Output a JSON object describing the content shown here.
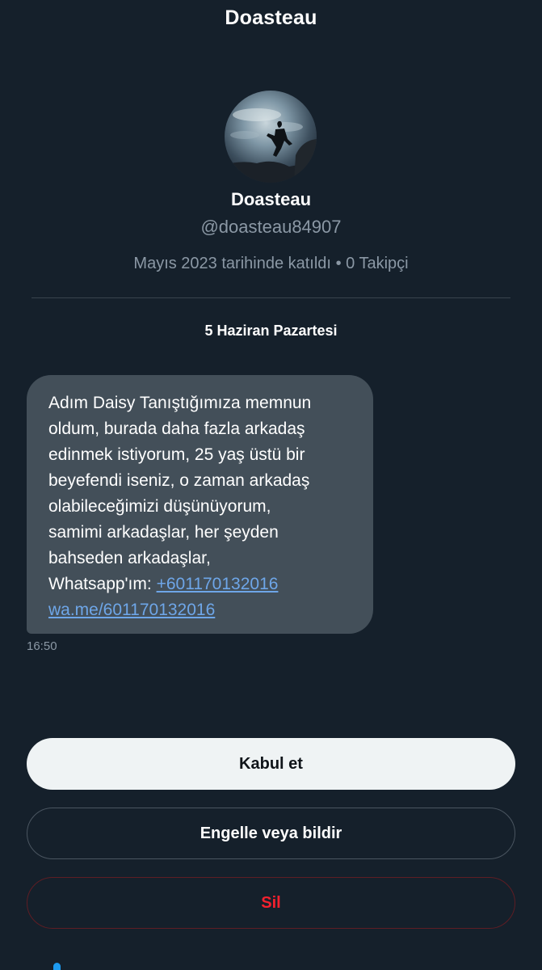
{
  "header": {
    "title": "Doasteau"
  },
  "profile": {
    "avatar_icon": "profile-avatar-photo",
    "name": "Doasteau",
    "handle": "@doasteau84907",
    "joined": "Mayıs 2023 tarihinde katıldı",
    "separator": "•",
    "followers": "0 Takipçi"
  },
  "conversation": {
    "date_separator": "5 Haziran Pazartesi",
    "message": {
      "lines": [
        "Adım Daisy Tanıştığımıza memnun",
        "oldum, burada daha fazla arkadaş",
        "edinmek istiyorum, 25 yaş üstü bir",
        "beyefendi iseniz, o zaman arkadaş",
        "olabileceğimizi düşünüyorum,",
        "samimi arkadaşlar, her şeyden",
        "bahseden arkadaşlar,"
      ],
      "whatsapp_prefix": "Whatsapp'ım:",
      "phone_link": "+601170132016",
      "wa_link": "wa.me/601170132016",
      "time": "16:50"
    }
  },
  "actions": {
    "accept_label": "Kabul et",
    "block_label": "Engelle veya bildir",
    "delete_label": "Sil"
  },
  "colors": {
    "background": "#15202b",
    "bubble": "#434f59",
    "link": "#6ea6e8",
    "danger": "#f4212e",
    "accent": "#1d9bf0"
  }
}
